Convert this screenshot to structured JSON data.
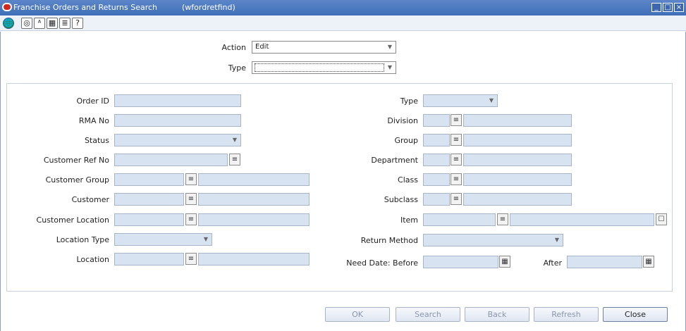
{
  "window": {
    "title": "Franchise Orders and Returns Search",
    "code": "(wfordretfind)",
    "controls": [
      "_",
      "□",
      "×"
    ]
  },
  "toolbar": {
    "icons": [
      "globe-icon",
      "web-help-icon",
      "find-text-icon",
      "calendar-icon",
      "print-icon",
      "help-icon"
    ],
    "glyphs": [
      "🌐",
      "◎",
      "ᴬ",
      "▦",
      "≣",
      "?"
    ]
  },
  "header": {
    "action_label": "Action",
    "action_value": "Edit",
    "type_label": "Type",
    "type_value": ""
  },
  "left": {
    "order_id": "Order ID",
    "rma_no": "RMA No",
    "status": "Status",
    "customer_ref_no": "Customer Ref No",
    "customer_group": "Customer Group",
    "customer": "Customer",
    "customer_location": "Customer Location",
    "location_type": "Location Type",
    "location": "Location"
  },
  "right": {
    "type": "Type",
    "division": "Division",
    "group": "Group",
    "department": "Department",
    "class": "Class",
    "subclass": "Subclass",
    "item": "Item",
    "return_method": "Return Method",
    "need_date_before": "Need Date: Before",
    "after": "After"
  },
  "buttons": {
    "ok": "OK",
    "search": "Search",
    "back": "Back",
    "refresh": "Refresh",
    "close": "Close"
  },
  "colors": {
    "title_bar": "#4a78c0",
    "field_fill": "#d8e3f2"
  }
}
